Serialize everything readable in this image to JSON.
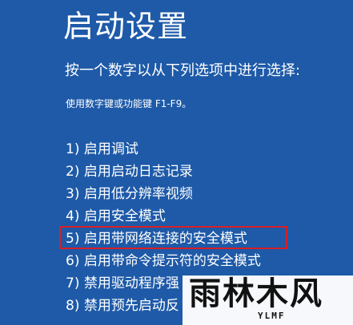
{
  "screen": {
    "title": "启动设置",
    "instruction": "按一个数字以从下列选项中进行选择:",
    "hint": "使用数字键或功能键 F1-F9。",
    "options": [
      {
        "label": "1) 启用调试",
        "highlighted": false
      },
      {
        "label": "2) 启用启动日志记录",
        "highlighted": false
      },
      {
        "label": "3) 启用低分辨率视频",
        "highlighted": false
      },
      {
        "label": "4) 启用安全模式",
        "highlighted": false
      },
      {
        "label": "5) 启用带网络连接的安全模式",
        "highlighted": true
      },
      {
        "label": "6) 启用带命令提示符的安全模式",
        "highlighted": false
      },
      {
        "label": "7) 禁用驱动程序强",
        "highlighted": false
      },
      {
        "label": "8) 禁用预先启动反",
        "highlighted": false
      }
    ]
  },
  "watermark": {
    "main": "雨林木风",
    "sub": "YLMF"
  },
  "colors": {
    "background": "#1e5aa8",
    "text": "#ffffff",
    "highlight_border": "#d91f26",
    "watermark_background": "#ffffff",
    "watermark_text": "#111111"
  }
}
